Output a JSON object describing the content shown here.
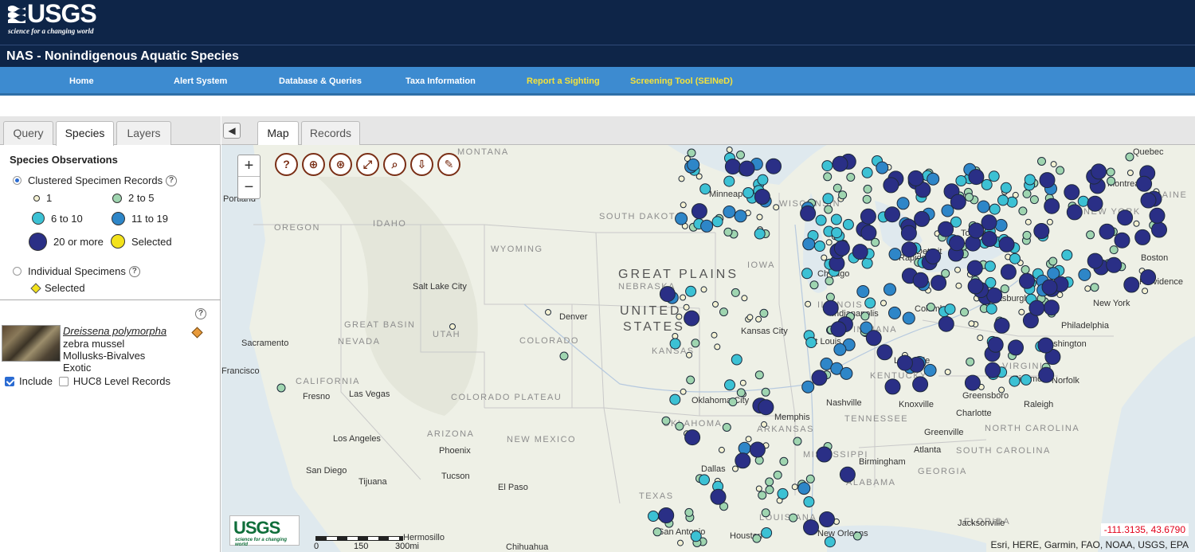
{
  "header": {
    "logo_word": "USGS",
    "logo_tagline": "science for a changing world",
    "site_title": "NAS - Nonindigenous Aquatic Species"
  },
  "nav": [
    {
      "label": "Home",
      "highlight": false
    },
    {
      "label": "Alert System",
      "highlight": false
    },
    {
      "label": "Database & Queries",
      "highlight": false
    },
    {
      "label": "Taxa Information",
      "highlight": false
    },
    {
      "label": "Report a Sighting",
      "highlight": true
    },
    {
      "label": "Screening Tool (SEINeD)",
      "highlight": true
    }
  ],
  "left_tabs": [
    {
      "label": "Query",
      "active": false
    },
    {
      "label": "Species",
      "active": true
    },
    {
      "label": "Layers",
      "active": false
    }
  ],
  "legend": {
    "title": "Species Observations",
    "clustered_label": "Clustered Specimen Records",
    "classes": [
      {
        "label": "1",
        "color": "#f4f1d2"
      },
      {
        "label": "2 to 5",
        "color": "#9fd5b0"
      },
      {
        "label": "6 to 10",
        "color": "#3cc1d4"
      },
      {
        "label": "11 to 19",
        "color": "#2e86c8"
      },
      {
        "label": "20 or more",
        "color": "#2a2f86"
      },
      {
        "label": "Selected",
        "color": "#f3e21b"
      }
    ],
    "individual_label": "Individual Specimens",
    "individual_selected": "Selected"
  },
  "species": {
    "scientific_name": "Dreissena polymorpha",
    "common_name": "zebra mussel",
    "group": "Mollusks-Bivalves",
    "status": "Exotic",
    "include_label": "Include",
    "huc_label": "HUC8 Level Records"
  },
  "map_tabs": [
    {
      "label": "Map",
      "active": true
    },
    {
      "label": "Records",
      "active": false
    }
  ],
  "map": {
    "zoom_in": "+",
    "zoom_out": "−",
    "coords": "-111.3135, 43.6790",
    "attribution": "Esri, HERE, Garmin, FAO, NOAA, USGS, EPA",
    "scale_labels": [
      "0",
      "150",
      "300mi"
    ],
    "colors": {
      "c1": "#f4f1d2",
      "c2": "#9fd5b0",
      "c3": "#3cc1d4",
      "c4": "#2e86c8",
      "c5": "#2a2f86"
    },
    "big_labels": [
      "GREAT PLAINS",
      "UNITED",
      "STATES"
    ],
    "state_labels": [
      "MONTANA",
      "OREGON",
      "IDAHO",
      "WYOMING",
      "SOUTH DAKOTA",
      "NEBRASKA",
      "IOWA",
      "WISCONSIN",
      "UTAH",
      "NEVADA",
      "COLORADO",
      "KANSAS",
      "CALIFORNIA",
      "ARIZONA",
      "NEW MEXICO",
      "OKLAHOMA",
      "TEXAS",
      "ALABAMA",
      "GEORGIA",
      "TENNESSEE",
      "KENTUCKY",
      "VIRGINIA",
      "NORTH CAROLINA",
      "SOUTH CAROLINA",
      "LOUISIANA",
      "FLORIDA",
      "MAINE",
      "NEW YORK",
      "INDIANA",
      "ILLINOIS",
      "ARKANSAS",
      "MISSISSIPPI",
      "GREAT BASIN",
      "COLORADO PLATEAU"
    ],
    "city_labels": [
      "Portland",
      "Denver",
      "Salt Lake City",
      "Sacramento",
      "Francisco",
      "Fresno",
      "Las Vegas",
      "Los Angeles",
      "San Diego",
      "Tijuana",
      "Phoenix",
      "Tucson",
      "El Paso",
      "Hermosillo",
      "Chihuahua",
      "Dallas",
      "San Antonio",
      "Houston",
      "New Orleans",
      "Memphis",
      "Nashville",
      "Knoxville",
      "Atlanta",
      "Birmingham",
      "Jacksonville",
      "Charlotte",
      "Greensboro",
      "Raleigh",
      "Richmond",
      "Norfolk",
      "Washington",
      "Philadelphia",
      "New York",
      "Boston",
      "Providence",
      "Montreal",
      "Quebec",
      "Toronto",
      "Chicago",
      "Indianapolis",
      "Columbus",
      "Pittsburgh",
      "Louisville",
      "St Louis",
      "Kansas City",
      "Oklahoma City",
      "Greenville",
      "Minneapolis",
      "Detroit",
      "Rapids"
    ]
  }
}
